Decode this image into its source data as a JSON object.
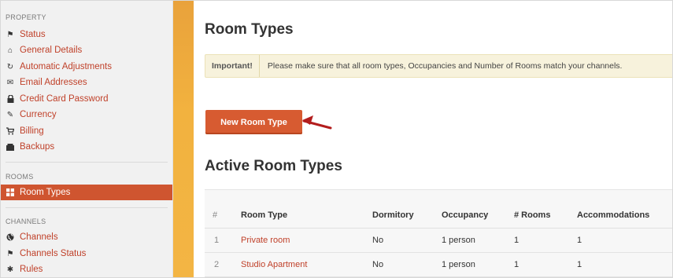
{
  "sidebar": {
    "sections": [
      {
        "title": "PROPERTY",
        "items": [
          {
            "label": "Status",
            "icon": "flag-icon"
          },
          {
            "label": "General Details",
            "icon": "home-icon"
          },
          {
            "label": "Automatic Adjustments",
            "icon": "refresh-icon"
          },
          {
            "label": "Email Addresses",
            "icon": "envelope-icon"
          },
          {
            "label": "Credit Card Password",
            "icon": "lock-icon"
          },
          {
            "label": "Currency",
            "icon": "edit-icon"
          },
          {
            "label": "Billing",
            "icon": "cart-icon"
          },
          {
            "label": "Backups",
            "icon": "hdd-icon"
          }
        ]
      },
      {
        "title": "ROOMS",
        "items": [
          {
            "label": "Room Types",
            "icon": "grid-icon",
            "active": true
          }
        ]
      },
      {
        "title": "CHANNELS",
        "items": [
          {
            "label": "Channels",
            "icon": "globe-icon"
          },
          {
            "label": "Channels Status",
            "icon": "flag-icon"
          },
          {
            "label": "Rules",
            "icon": "asterisk-icon"
          }
        ]
      }
    ]
  },
  "main": {
    "title": "Room Types",
    "alert": {
      "strong": "Important!",
      "message": "Please make sure that all room types, Occupancies and Number of Rooms match your channels."
    },
    "new_button_label": "New Room Type",
    "active_heading": "Active Room Types",
    "table": {
      "columns": [
        "#",
        "Room Type",
        "Dormitory",
        "Occupancy",
        "# Rooms",
        "Accommodations"
      ],
      "rows": [
        {
          "num": "1",
          "name": "Private room",
          "dormitory": "No",
          "occupancy": "1 person",
          "rooms": "1",
          "accommodations": "1"
        },
        {
          "num": "2",
          "name": "Studio Apartment",
          "dormitory": "No",
          "occupancy": "1 person",
          "rooms": "1",
          "accommodations": "1"
        }
      ]
    }
  },
  "colors": {
    "accent": "#cf5530",
    "link": "#c0412a",
    "band": "#f2b23f",
    "alert_bg": "#f7f2dc",
    "arrow": "#b31d1d"
  }
}
